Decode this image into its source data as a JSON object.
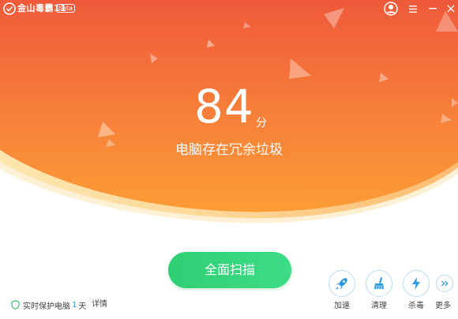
{
  "app": {
    "title": "金山毒霸11",
    "beta": "beta"
  },
  "score": {
    "value": "84",
    "unit": "分",
    "caption": "电脑存在冗余垃圾"
  },
  "scan_button": {
    "label": "全面扫描"
  },
  "tools": [
    {
      "label": "加速",
      "icon": "rocket-icon"
    },
    {
      "label": "清理",
      "icon": "broom-icon"
    },
    {
      "label": "杀毒",
      "icon": "lightning-icon"
    },
    {
      "label": "更多",
      "icon": "double-chevron-right-icon"
    }
  ],
  "status": {
    "prefix": "实时保护电脑",
    "days": "1",
    "suffix": "天",
    "details_link": "详情"
  },
  "colors": {
    "hero_top": "#f0583a",
    "hero_bottom": "#fb9a35",
    "scan_button": "#34d47b",
    "tool_accent": "#2d9be0"
  }
}
